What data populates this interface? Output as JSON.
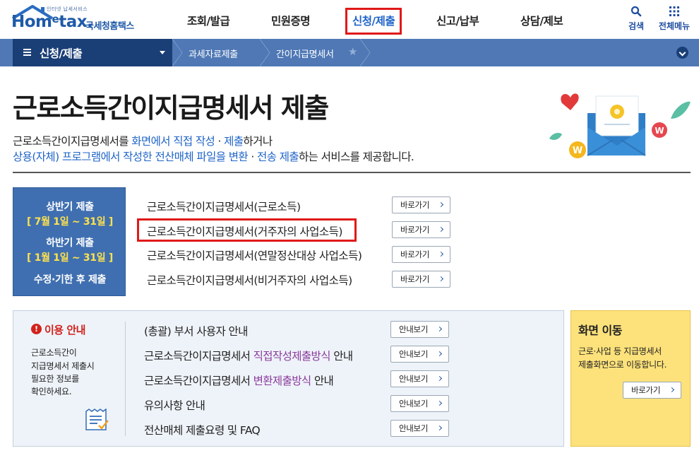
{
  "header": {
    "logo_small": "인터넷 납세서비스",
    "logo_main": "Hom",
    "logo_e": "e",
    "logo_tail": "tax.",
    "logo_kr": "국세청홈택스",
    "nav": [
      "조회/발급",
      "민원증명",
      "신청/제출",
      "신고/납부",
      "상담/제보"
    ],
    "active_nav_index": 2,
    "search_label": "검색",
    "menu_label": "전체메뉴"
  },
  "locbar": {
    "menu_label": "신청/제출",
    "crumbs": [
      "과세자료제출",
      "간이지급명세서"
    ],
    "star": "★"
  },
  "main": {
    "title": "근로소득간이지급명세서 제출",
    "desc_line1": {
      "a": "근로소득간이지급명세서를 ",
      "b": "화면에서 직접 작성",
      "c": " · ",
      "d": "제출",
      "e": "하거나"
    },
    "desc_line2": {
      "a": "상용(자체) 프로그램에서 작성한 전산매체 파일을 변환",
      "b": " · ",
      "c": "전송 제출",
      "d": "하는 서비스를 제공합니다."
    }
  },
  "period": {
    "first_label": "상반기 제출",
    "first_date": "[ 7월 1일 ~ 31일 ]",
    "second_label": "하반기 제출",
    "second_date": "[ 1월 1일 ~ 31일 ]",
    "late_label": "수정·기한 후 제출"
  },
  "submissions": {
    "items": [
      "근로소득간이지급명세서(근로소득)",
      "근로소득간이지급명세서(거주자의 사업소득)",
      "근로소득간이지급명세서(연말정산대상 사업소득)",
      "근로소득간이지급명세서(비거주자의 사업소득)"
    ],
    "button_label": "바로가기"
  },
  "info": {
    "title": "이용 안내",
    "bang": "!",
    "lines": [
      "근로소득간이",
      "지급명세서 제출시",
      "필요한 정보를",
      "확인하세요."
    ],
    "guides": {
      "g1": "(총괄) 부서 사용자 안내",
      "g2_a": "근로소득간이지급명세서 ",
      "g2_b": "직접작성제출방식",
      "g2_c": " 안내",
      "g3_a": "근로소득간이지급명세서 ",
      "g3_b": "변환제출방식",
      "g3_c": " 안내",
      "g4": "유의사항 안내",
      "g5": "전산매체 제출요령 및 FAQ"
    },
    "button_label": "안내보기"
  },
  "move": {
    "title": "화면 이동",
    "line1": "근로·사업 등 지급명세서",
    "line2": "제출화면으로 이동합니다.",
    "button_label": "바로가기"
  },
  "colors": {
    "brand_blue": "#1f5aa8",
    "nav_active": "#1f64c8",
    "highlight_red": "#e01919",
    "period_date_yellow": "#ffe14d",
    "purple_text": "#8a3a9c",
    "move_panel": "#fde27b"
  }
}
